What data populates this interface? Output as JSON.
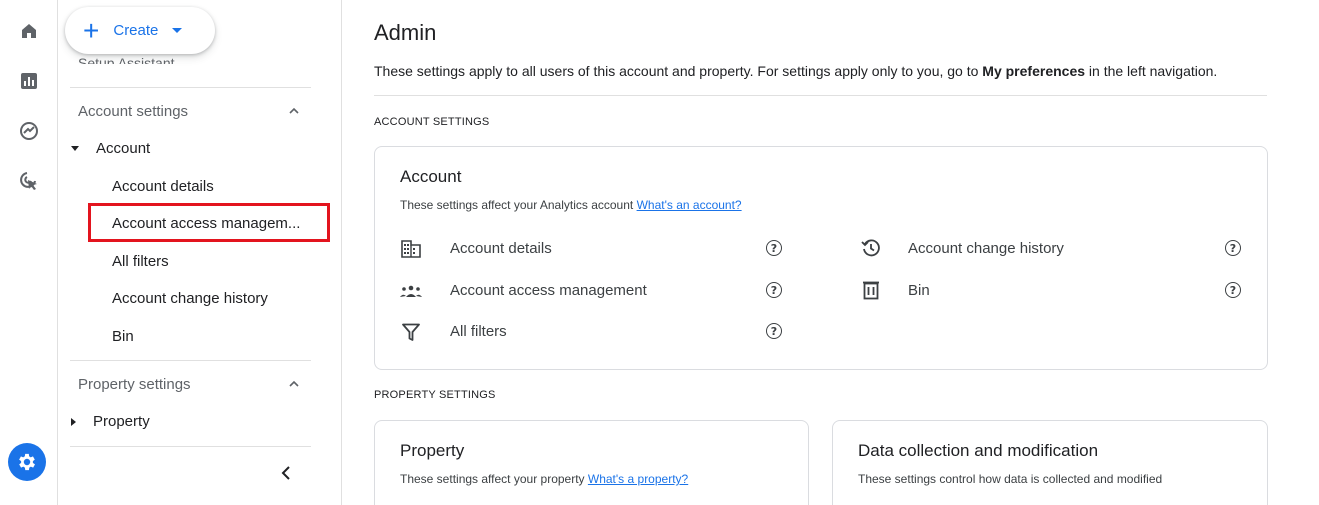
{
  "create": {
    "label": "Create"
  },
  "sidebar": {
    "setup_assistant": "Setup Assistant",
    "account_settings": "Account settings",
    "account_group": "Account",
    "account_items": [
      "Account details",
      "Account access managem...",
      "All filters",
      "Account change history",
      "Bin"
    ],
    "property_settings": "Property settings",
    "property_group": "Property"
  },
  "main": {
    "title": "Admin",
    "subtitle_pre": "These settings apply to all users of this account and property. For settings apply only to you, go to ",
    "subtitle_bold": "My preferences",
    "subtitle_post": " in the left navigation.",
    "account_settings_label": "ACCOUNT SETTINGS",
    "property_settings_label": "PROPERTY SETTINGS",
    "account_card": {
      "title": "Account",
      "desc": "These settings affect your Analytics account ",
      "link": "What's an account?",
      "rows": [
        {
          "icon": "building-icon",
          "label": "Account details"
        },
        {
          "icon": "history-icon",
          "label": "Account change history"
        },
        {
          "icon": "people-icon",
          "label": "Account access management"
        },
        {
          "icon": "trash-icon",
          "label": "Bin"
        },
        {
          "icon": "filter-icon",
          "label": "All filters"
        }
      ]
    },
    "property_card": {
      "title": "Property",
      "desc": "These settings affect your property ",
      "link": "What's a property?"
    },
    "data_card": {
      "title": "Data collection and modification",
      "desc": "These settings control how data is collected and modified"
    }
  },
  "help_glyph": "?",
  "colors": {
    "accent": "#1a73e8",
    "highlight_border": "#e3141e"
  }
}
